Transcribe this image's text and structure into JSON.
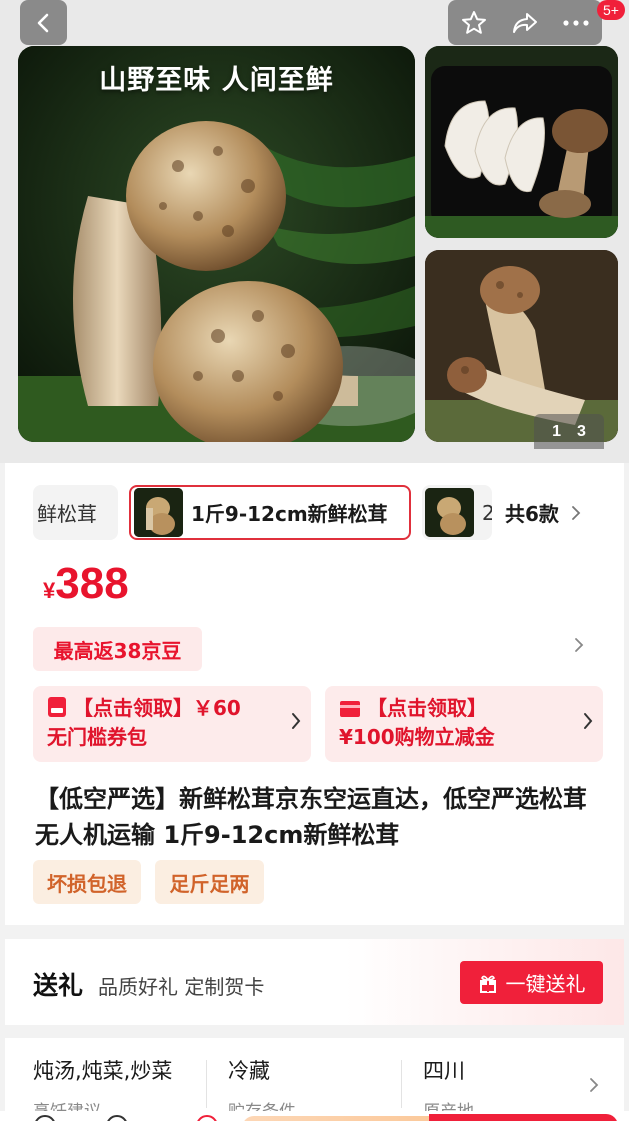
{
  "gallery": {
    "slogan": "山野至味 人间至鲜",
    "counter_current": "1",
    "counter_total": "3",
    "notification_badge": "5+",
    "icons": [
      "back-icon",
      "star-icon",
      "share-icon",
      "more-icon"
    ]
  },
  "variants": {
    "prev_label": "鲜松茸",
    "selected_label": "1斤9-12cm新鲜松茸",
    "next_label": "2",
    "total_label": "共6款"
  },
  "price": {
    "currency": "¥",
    "amount": "388"
  },
  "rebate": {
    "label": "最高返38京豆"
  },
  "coupons": [
    {
      "line1": "【点击领取】￥60",
      "line2": "无门槛券包",
      "icon": "coupon-ticket-icon"
    },
    {
      "line1": "【点击领取】",
      "line2": "¥100购物立减金",
      "icon": "card-icon"
    }
  ],
  "product": {
    "title": "【低空严选】新鲜松茸京东空运直达，低空严选松茸 无人机运输 1斤9-12cm新鲜松茸",
    "tags": [
      "坏损包退",
      "足斤足两"
    ]
  },
  "gift": {
    "title": "送礼",
    "subtitle": "品质好礼 定制贺卡",
    "button_label": "一键送礼"
  },
  "attributes": [
    {
      "value": "炖汤,炖菜,炒菜",
      "key": "烹饪建议"
    },
    {
      "value": "冷藏",
      "key": "贮存条件"
    },
    {
      "value": "四川",
      "key": "原产地"
    }
  ],
  "colors": {
    "accent_red": "#e8142d",
    "coupon_bg": "#fdebeb",
    "tag_text": "#d1632a",
    "tag_bg": "#fbeee1"
  }
}
